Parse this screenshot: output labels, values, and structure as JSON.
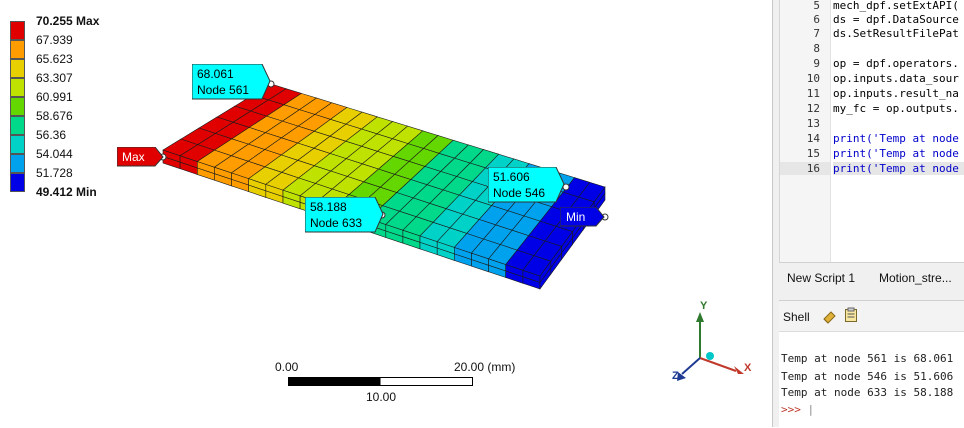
{
  "legend": {
    "max_value": "70.255",
    "max_suffix": "Max",
    "min_value": "49.412",
    "min_suffix": "Min",
    "levels": [
      "70.255 Max",
      "67.939",
      "65.623",
      "63.307",
      "60.991",
      "58.676",
      "56.36",
      "54.044",
      "51.728",
      "49.412 Min"
    ],
    "colors": [
      "#e00000",
      "#ff9d00",
      "#e8cf00",
      "#bfe200",
      "#64d600",
      "#00d88a",
      "#00d2c8",
      "#00a2ee",
      "#0000e6"
    ]
  },
  "probes": [
    {
      "value": "68.061",
      "node": "Node 561"
    },
    {
      "value": "51.606",
      "node": "Node 546"
    },
    {
      "value": "58.188",
      "node": "Node 633"
    }
  ],
  "tags": {
    "max": "Max",
    "min": "Min"
  },
  "scale_bar": {
    "start": "0.00",
    "end": "20.00 (mm)",
    "mid": "10.00"
  },
  "triad": {
    "x": "X",
    "y": "Y",
    "z": "Z"
  },
  "editor": {
    "lines": [
      {
        "num": "5",
        "text": "mech_dpf.setExtAPI("
      },
      {
        "num": "6",
        "text": "ds = dpf.DataSource"
      },
      {
        "num": "7",
        "text": "ds.SetResultFilePat"
      },
      {
        "num": "8",
        "text": ""
      },
      {
        "num": "9",
        "text": "op = dpf.operators."
      },
      {
        "num": "10",
        "text": "op.inputs.data_sour"
      },
      {
        "num": "11",
        "text": "op.inputs.result_na"
      },
      {
        "num": "12",
        "text": "my_fc = op.outputs."
      },
      {
        "num": "13",
        "text": ""
      },
      {
        "num": "14",
        "text": "print('Temp at node"
      },
      {
        "num": "15",
        "text": "print('Temp at node"
      },
      {
        "num": "16",
        "text": "print('Temp at node"
      }
    ]
  },
  "tabs": [
    "New Script 1",
    "Motion_stre..."
  ],
  "shell": {
    "title": "Shell",
    "output": [
      "Temp at node 561 is 68.061",
      "Temp at node 546 is 51.606",
      "Temp at node 633 is 58.188"
    ],
    "prompt": ">>>"
  }
}
